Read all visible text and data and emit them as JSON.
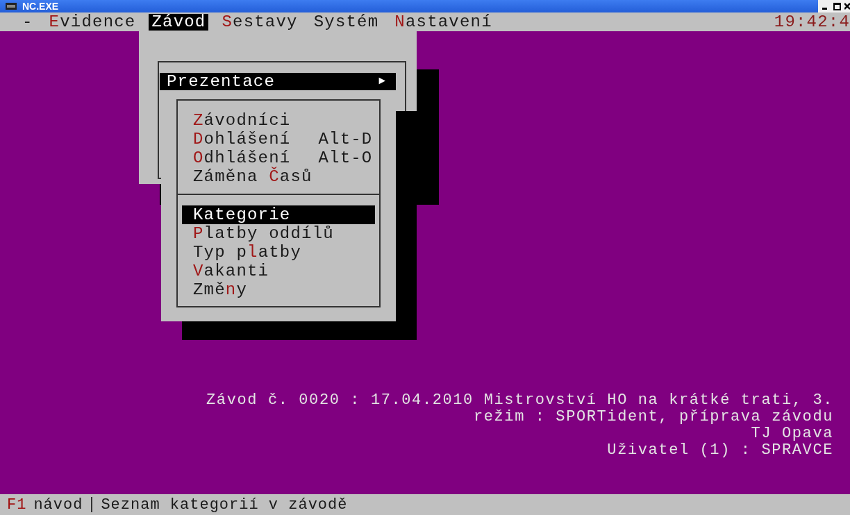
{
  "window": {
    "title": "NC.EXE"
  },
  "menu_bar": {
    "items": [
      {
        "after": "-",
        "selected": false
      },
      {
        "hotkey": "E",
        "after": "vidence",
        "selected": false
      },
      {
        "after": "Závod",
        "selected": true
      },
      {
        "hotkey": "S",
        "after": "estavy",
        "selected": false
      },
      {
        "after": "Systém",
        "selected": false
      },
      {
        "hotkey": "N",
        "after": "astavení",
        "selected": false
      }
    ],
    "clock": "19:42:4"
  },
  "dropdown": {
    "items": [
      {
        "after": "Prezentace",
        "arrow": "►",
        "selected": true
      }
    ]
  },
  "submenu": {
    "groups": [
      {
        "items": [
          {
            "hotkey": "Z",
            "after": "ávodníci",
            "selected": false
          },
          {
            "hotkey": "D",
            "after": "ohlášení",
            "shortcut": "Alt-D",
            "selected": false
          },
          {
            "hotkey": "O",
            "after": "dhlášení",
            "shortcut": "Alt-O",
            "selected": false
          },
          {
            "before": "Záměna ",
            "hotkey": "Č",
            "after": "asů",
            "selected": false
          }
        ]
      },
      {
        "items": [
          {
            "after": "Kategorie",
            "selected": true
          },
          {
            "hotkey": "P",
            "after": "latby oddílů",
            "selected": false
          },
          {
            "before": "Typ p",
            "hotkey": "l",
            "after": "atby",
            "selected": false
          },
          {
            "hotkey": "V",
            "after": "akanti",
            "selected": false
          },
          {
            "before": "Změ",
            "hotkey": "n",
            "after": "y",
            "selected": false
          }
        ]
      }
    ]
  },
  "info_lines": [
    "Závod č. 0020 : 17.04.2010 Mistrovství HO na krátké trati, 3.",
    "režim : SPORTident, příprava závodu",
    "TJ Opava",
    "Uživatel (1) : SPRAVCE"
  ],
  "status_bar": {
    "key": "F1",
    "key_label": "návod",
    "message": "Seznam kategorií v závodě"
  }
}
